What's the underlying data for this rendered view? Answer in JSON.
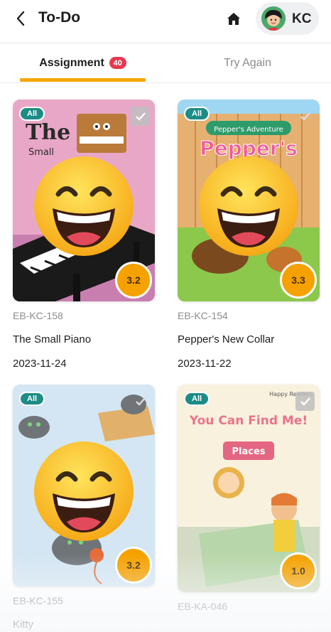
{
  "header": {
    "title": "To-Do",
    "back_icon": "chevron-left-icon",
    "home_icon": "home-icon",
    "user_initials": "KC"
  },
  "tabs": [
    {
      "label": "Assignment",
      "badge": "40",
      "active": true
    },
    {
      "label": "Try Again",
      "active": false
    }
  ],
  "colors": {
    "accent": "#f5a600",
    "badge": "#e53950",
    "tag": "#1d8c86",
    "level": "#f5a100"
  },
  "books": [
    {
      "tag": "All",
      "code": "EB-KC-158",
      "title": "The Small Piano",
      "date": "2023-11-24",
      "level": "3.2",
      "cover_text": [
        "The",
        "Small"
      ]
    },
    {
      "tag": "All",
      "code": "EB-KC-154",
      "title": "Pepper's New Collar",
      "date": "2023-11-22",
      "level": "3.3",
      "cover_text": [
        "Pepper's Adventure",
        "Pepper's"
      ]
    },
    {
      "tag": "All",
      "code": "EB-KC-155",
      "title": "Kitty",
      "level": "3.2"
    },
    {
      "tag": "All",
      "code": "EB-KA-046",
      "level": "1.0",
      "cover_text": [
        "Happy Readers",
        "You Can Find Me!",
        "Places"
      ]
    }
  ]
}
